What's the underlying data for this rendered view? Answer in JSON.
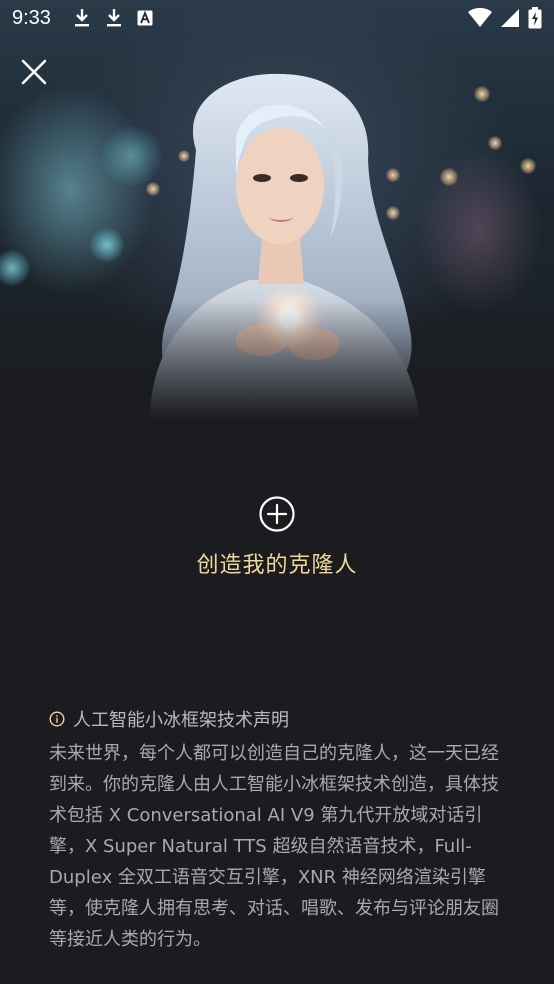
{
  "status_bar": {
    "time": "9:33",
    "left_icons": [
      "download-icon",
      "download-icon",
      "translate-icon"
    ],
    "right_icons": [
      "wifi-icon",
      "signal-icon",
      "battery-charging-icon"
    ]
  },
  "hero": {
    "image": "portrait-illustration"
  },
  "create": {
    "label": "创造我的克隆人",
    "icon": "plus-circle-icon"
  },
  "disclaimer": {
    "title": "人工智能小冰框架技术声明",
    "body": "未来世界，每个人都可以创造自己的克隆人，这一天已经到来。你的克隆人由人工智能小冰框架技术创造，具体技术包括 X Conversational AI V9 第九代开放域对话引擎，X Super Natural TTS 超级自然语音技术，Full-Duplex 全双工语音交互引擎，XNR 神经网络渲染引擎等，使克隆人拥有思考、对话、唱歌、发布与评论朋友圈等接近人类的行为。"
  },
  "colors": {
    "background": "#1b1c20",
    "accent": "#f1d79c",
    "text_muted": "#a9a9ae"
  }
}
